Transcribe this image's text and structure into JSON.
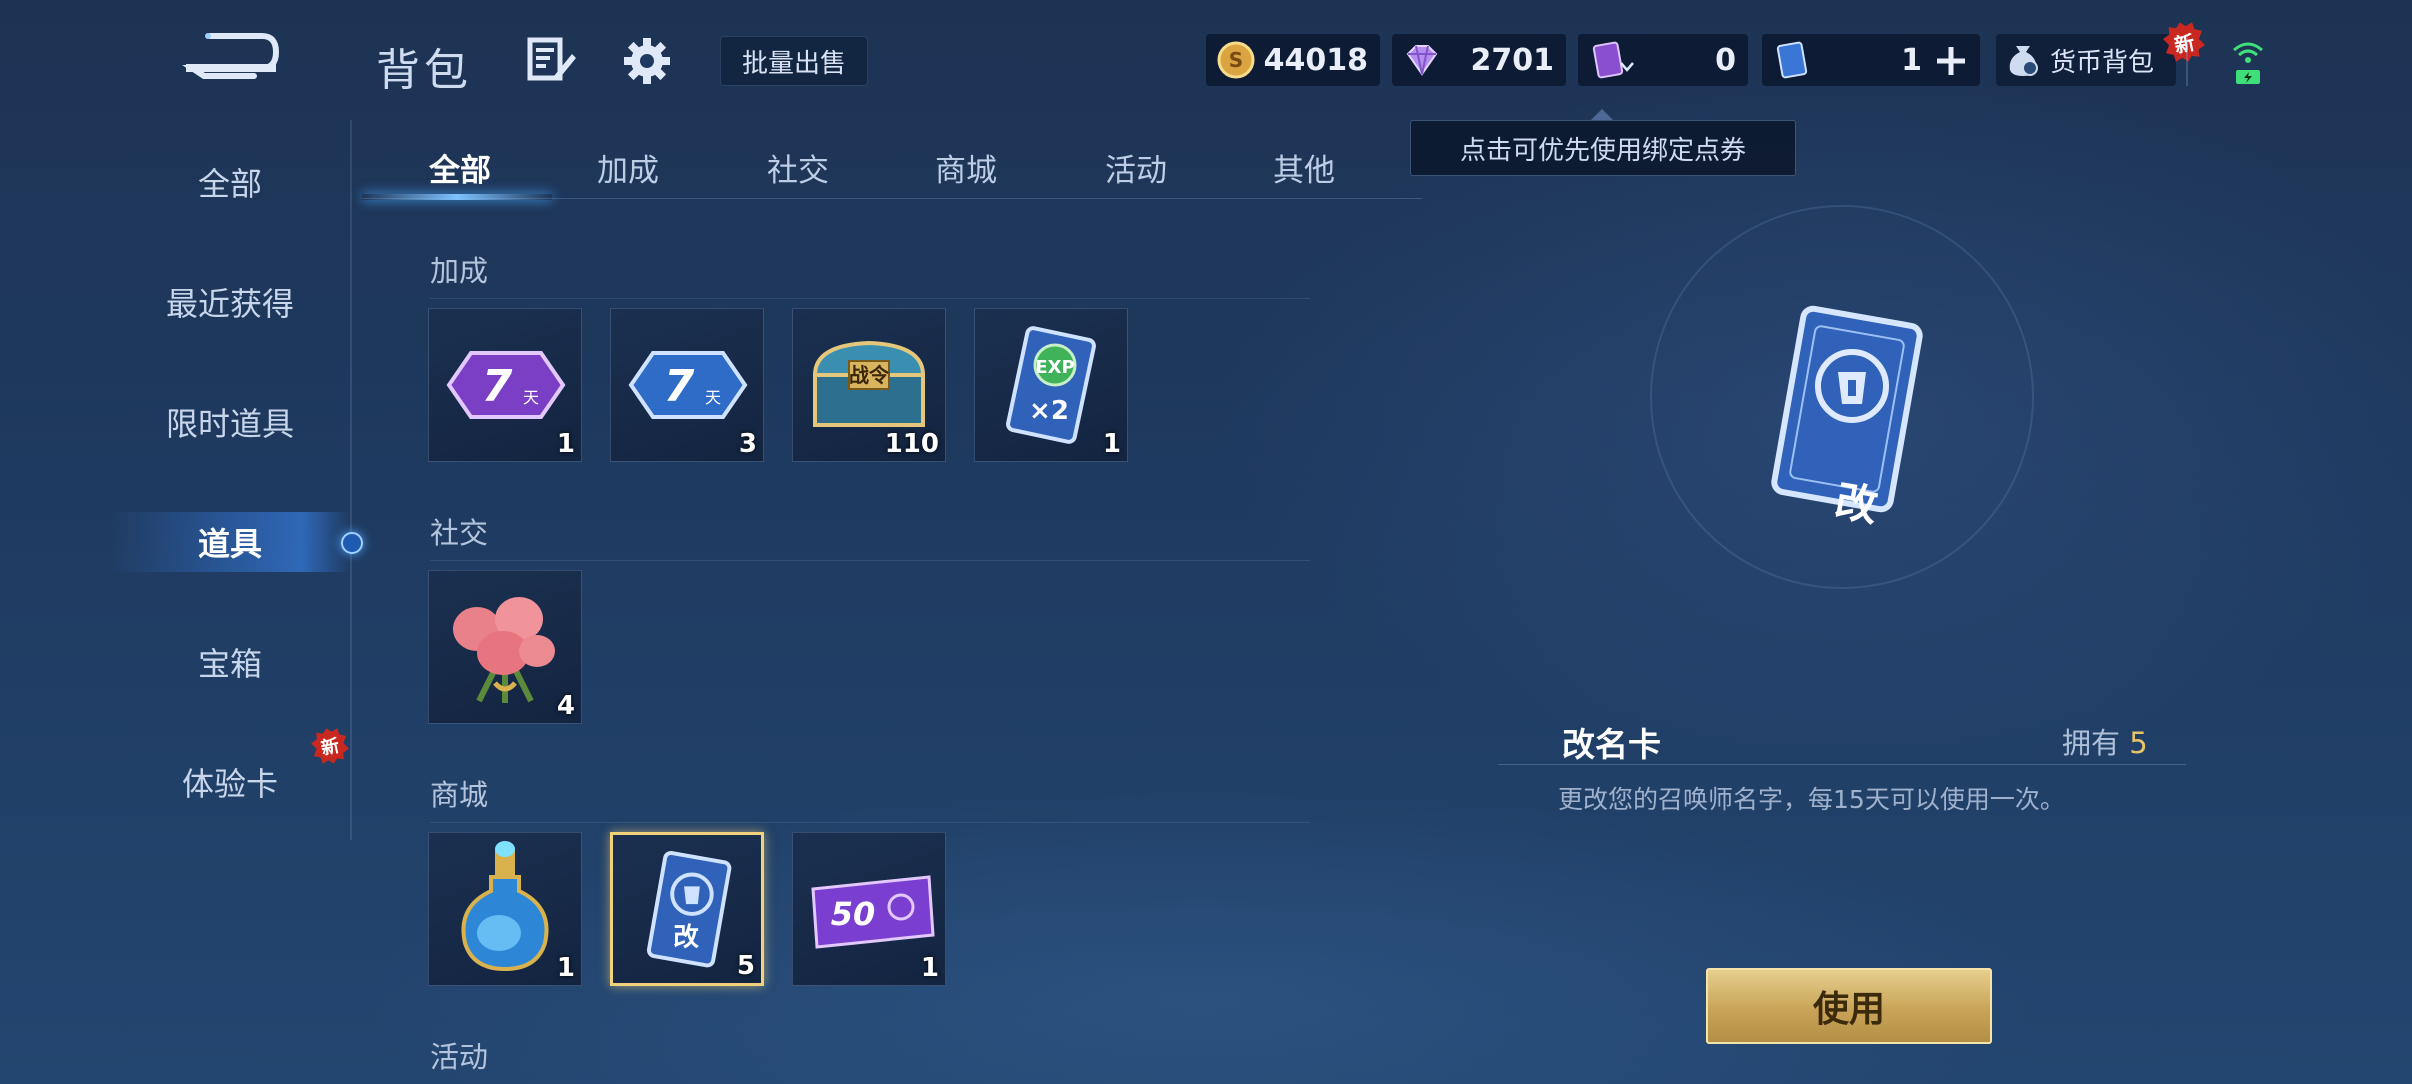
{
  "header": {
    "title": "背包",
    "batch_sell": "批量出售",
    "currencies": [
      {
        "name": "gold-coin",
        "value": "44018"
      },
      {
        "name": "diamond",
        "value": "2701"
      },
      {
        "name": "bound-voucher",
        "value": "0"
      },
      {
        "name": "voucher",
        "value": "1"
      }
    ],
    "wallet_label": "货币背包",
    "new_badge": "新",
    "tooltip": "点击可优先使用绑定点券"
  },
  "sidebar": {
    "items": [
      {
        "label": "全部"
      },
      {
        "label": "最近获得"
      },
      {
        "label": "限时道具"
      },
      {
        "label": "道具"
      },
      {
        "label": "宝箱"
      },
      {
        "label": "体验卡"
      }
    ],
    "active_index": 3,
    "new_badge": "新"
  },
  "tabs": [
    {
      "label": "全部"
    },
    {
      "label": "加成"
    },
    {
      "label": "社交"
    },
    {
      "label": "商城"
    },
    {
      "label": "活动"
    },
    {
      "label": "其他"
    }
  ],
  "sections": [
    {
      "title": "加成",
      "items": [
        {
          "icon": "purple-7day-card-icon",
          "count": "1",
          "text": "7天"
        },
        {
          "icon": "blue-7day-card-icon",
          "count": "3",
          "text": "7天"
        },
        {
          "icon": "battle-pass-chest-icon",
          "count": "110",
          "text": "战令"
        },
        {
          "icon": "exp-x2-card-icon",
          "count": "1",
          "text": "EXP ×2"
        }
      ]
    },
    {
      "title": "社交",
      "items": [
        {
          "icon": "rose-bouquet-icon",
          "count": "4"
        }
      ]
    },
    {
      "title": "商城",
      "items": [
        {
          "icon": "potion-bottle-icon",
          "count": "1"
        },
        {
          "icon": "rename-card-icon",
          "count": "5",
          "text": "改"
        },
        {
          "icon": "purple-50-ticket-icon",
          "count": "1",
          "text": "50"
        }
      ]
    },
    {
      "title": "活动",
      "items": []
    }
  ],
  "detail": {
    "name": "改名卡",
    "own_label": "拥有",
    "own_count": "5",
    "description": "更改您的召唤师名字，每15天可以使用一次。",
    "card_text": "改",
    "use_button": "使用"
  },
  "colors": {
    "gold": "#e7c46a",
    "accent_blue": "#4aa8ff",
    "badge_red": "#c8281f"
  }
}
